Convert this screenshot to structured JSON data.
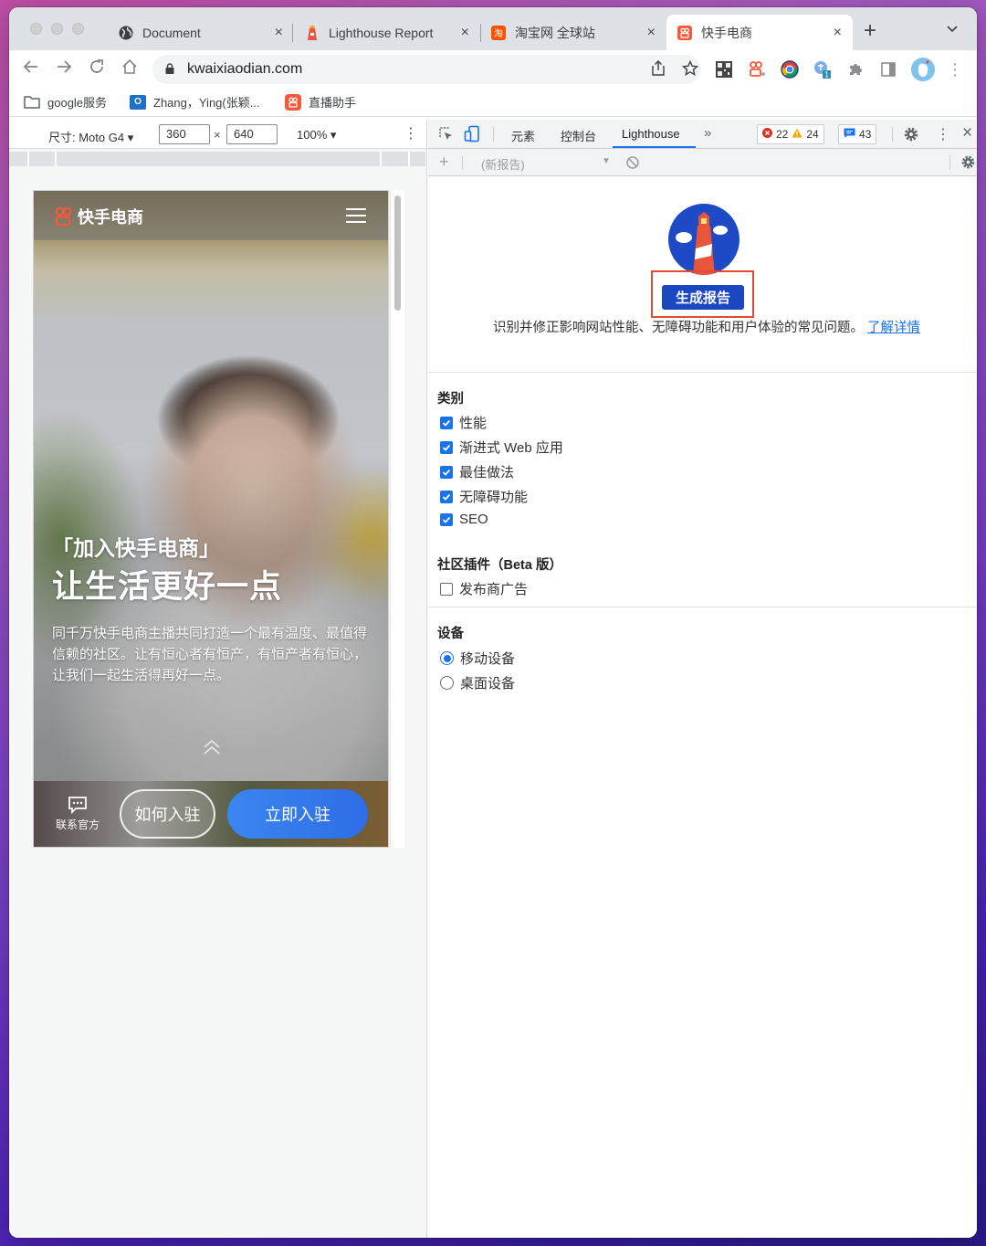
{
  "browser": {
    "tabs": [
      {
        "title": "Document",
        "icon": "globe-icon",
        "active": false
      },
      {
        "title": "Lighthouse Report",
        "icon": "lighthouse-icon",
        "active": false
      },
      {
        "title": "淘宝网 全球站",
        "icon": "taobao-icon",
        "favicon_text": "淘",
        "active": false
      },
      {
        "title": "快手电商",
        "icon": "kuaishou-icon",
        "active": true
      }
    ],
    "close_glyph": "×",
    "new_tab_glyph": "+",
    "tab_search_glyph": "⌄",
    "url": "kwaixiaodian.com",
    "extension_badge": "1",
    "bookmarks": [
      {
        "label": "google服务",
        "icon": "folder-icon"
      },
      {
        "label": "Zhang，Ying(张颖...",
        "icon": "outlook-icon",
        "icon_text": "O"
      },
      {
        "label": "直播助手",
        "icon": "kuaishou-icon"
      }
    ]
  },
  "emulation": {
    "device_label": "尺寸: Moto G4 ▾",
    "width": "360",
    "height": "640",
    "times": "×",
    "zoom": "100% ▾",
    "more": "⋮"
  },
  "mobile_page": {
    "brand": "快手电商",
    "slogan_line1": "「加入快手电商」",
    "slogan_line2": "让生活更好一点",
    "description": "同千万快手电商主播共同打造一个最有温度、最值得信赖的社区。让有恒心者有恒产，有恒产者有恒心，让我们一起生活得再好一点。",
    "contact_label": "联系官方",
    "how_to_join": "如何入驻",
    "join_now": "立即入驻",
    "accent_color": "#3a86f2",
    "brand_color": "#f5583a"
  },
  "devtools": {
    "tabs": [
      "元素",
      "控制台",
      "Lighthouse"
    ],
    "active_tab": "Lighthouse",
    "overflow": "»",
    "errors": "22",
    "warnings": "24",
    "messages": "43",
    "report_select": "(新报告)",
    "add": "+",
    "close": "×",
    "more": "⋮"
  },
  "lighthouse": {
    "generate_button": "生成报告",
    "description": "识别并修正影响网站性能、无障碍功能和用户体验的常见问题。",
    "learn_more": "了解详情",
    "categories_title": "类别",
    "categories": [
      {
        "label": "性能",
        "checked": true
      },
      {
        "label": "渐进式 Web 应用",
        "checked": true
      },
      {
        "label": "最佳做法",
        "checked": true
      },
      {
        "label": "无障碍功能",
        "checked": true
      },
      {
        "label": "SEO",
        "checked": true
      }
    ],
    "plugins_title": "社区插件（Beta 版）",
    "plugins": [
      {
        "label": "发布商广告",
        "checked": false
      }
    ],
    "device_title": "设备",
    "devices": [
      {
        "label": "移动设备",
        "selected": true
      },
      {
        "label": "桌面设备",
        "selected": false
      }
    ],
    "highlight_color": "#e34a33",
    "button_color": "#1a47c2"
  }
}
